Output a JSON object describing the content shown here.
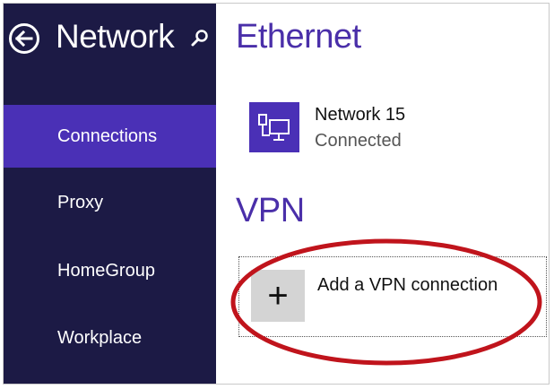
{
  "sidebar": {
    "title": "Network",
    "back_icon": "back-arrow-circle-icon",
    "search_icon": "search-icon",
    "items": [
      {
        "label": "Connections",
        "selected": true
      },
      {
        "label": "Proxy",
        "selected": false
      },
      {
        "label": "HomeGroup",
        "selected": false
      },
      {
        "label": "Workplace",
        "selected": false
      }
    ]
  },
  "main": {
    "ethernet": {
      "heading": "Ethernet",
      "network": {
        "name": "Network  15",
        "status": "Connected",
        "icon": "wired-network-icon"
      }
    },
    "vpn": {
      "heading": "VPN",
      "add_label": "Add a VPN connection",
      "add_icon": "plus-icon"
    }
  },
  "colors": {
    "sidebar_bg": "#1c1a45",
    "accent": "#4a30b6",
    "heading": "#4a2fa9",
    "annotation": "#c0141c",
    "tile_gray": "#d4d4d4"
  }
}
